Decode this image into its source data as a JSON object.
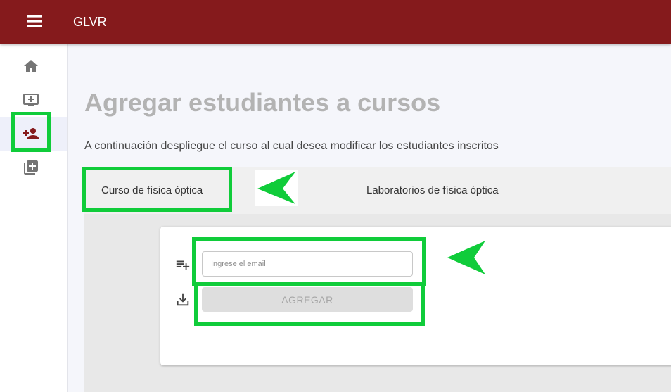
{
  "appbar": {
    "title": "GLVR",
    "color": "#851a1c"
  },
  "sidebar": {
    "items": [
      {
        "id": "home",
        "icon": "home-icon",
        "active": false
      },
      {
        "id": "add-course",
        "icon": "add-to-queue-icon",
        "active": false
      },
      {
        "id": "add-student",
        "icon": "person-add-icon",
        "active": true
      },
      {
        "id": "library-add",
        "icon": "library-add-icon",
        "active": false
      }
    ]
  },
  "main": {
    "title": "Agregar estudiantes a cursos",
    "subtitle": "A continuación despliegue el curso al cual desea modificar los estudiantes inscritos",
    "tabs": [
      {
        "label": "Curso de física óptica",
        "selected": true
      },
      {
        "label": "Laboratorios de física óptica",
        "selected": false
      }
    ],
    "form": {
      "email_placeholder": "Ingrese el email",
      "email_value": "",
      "add_button_label": "AGREGAR",
      "add_button_disabled": true
    }
  },
  "annotations": {
    "highlight_color": "#10cc3a"
  }
}
